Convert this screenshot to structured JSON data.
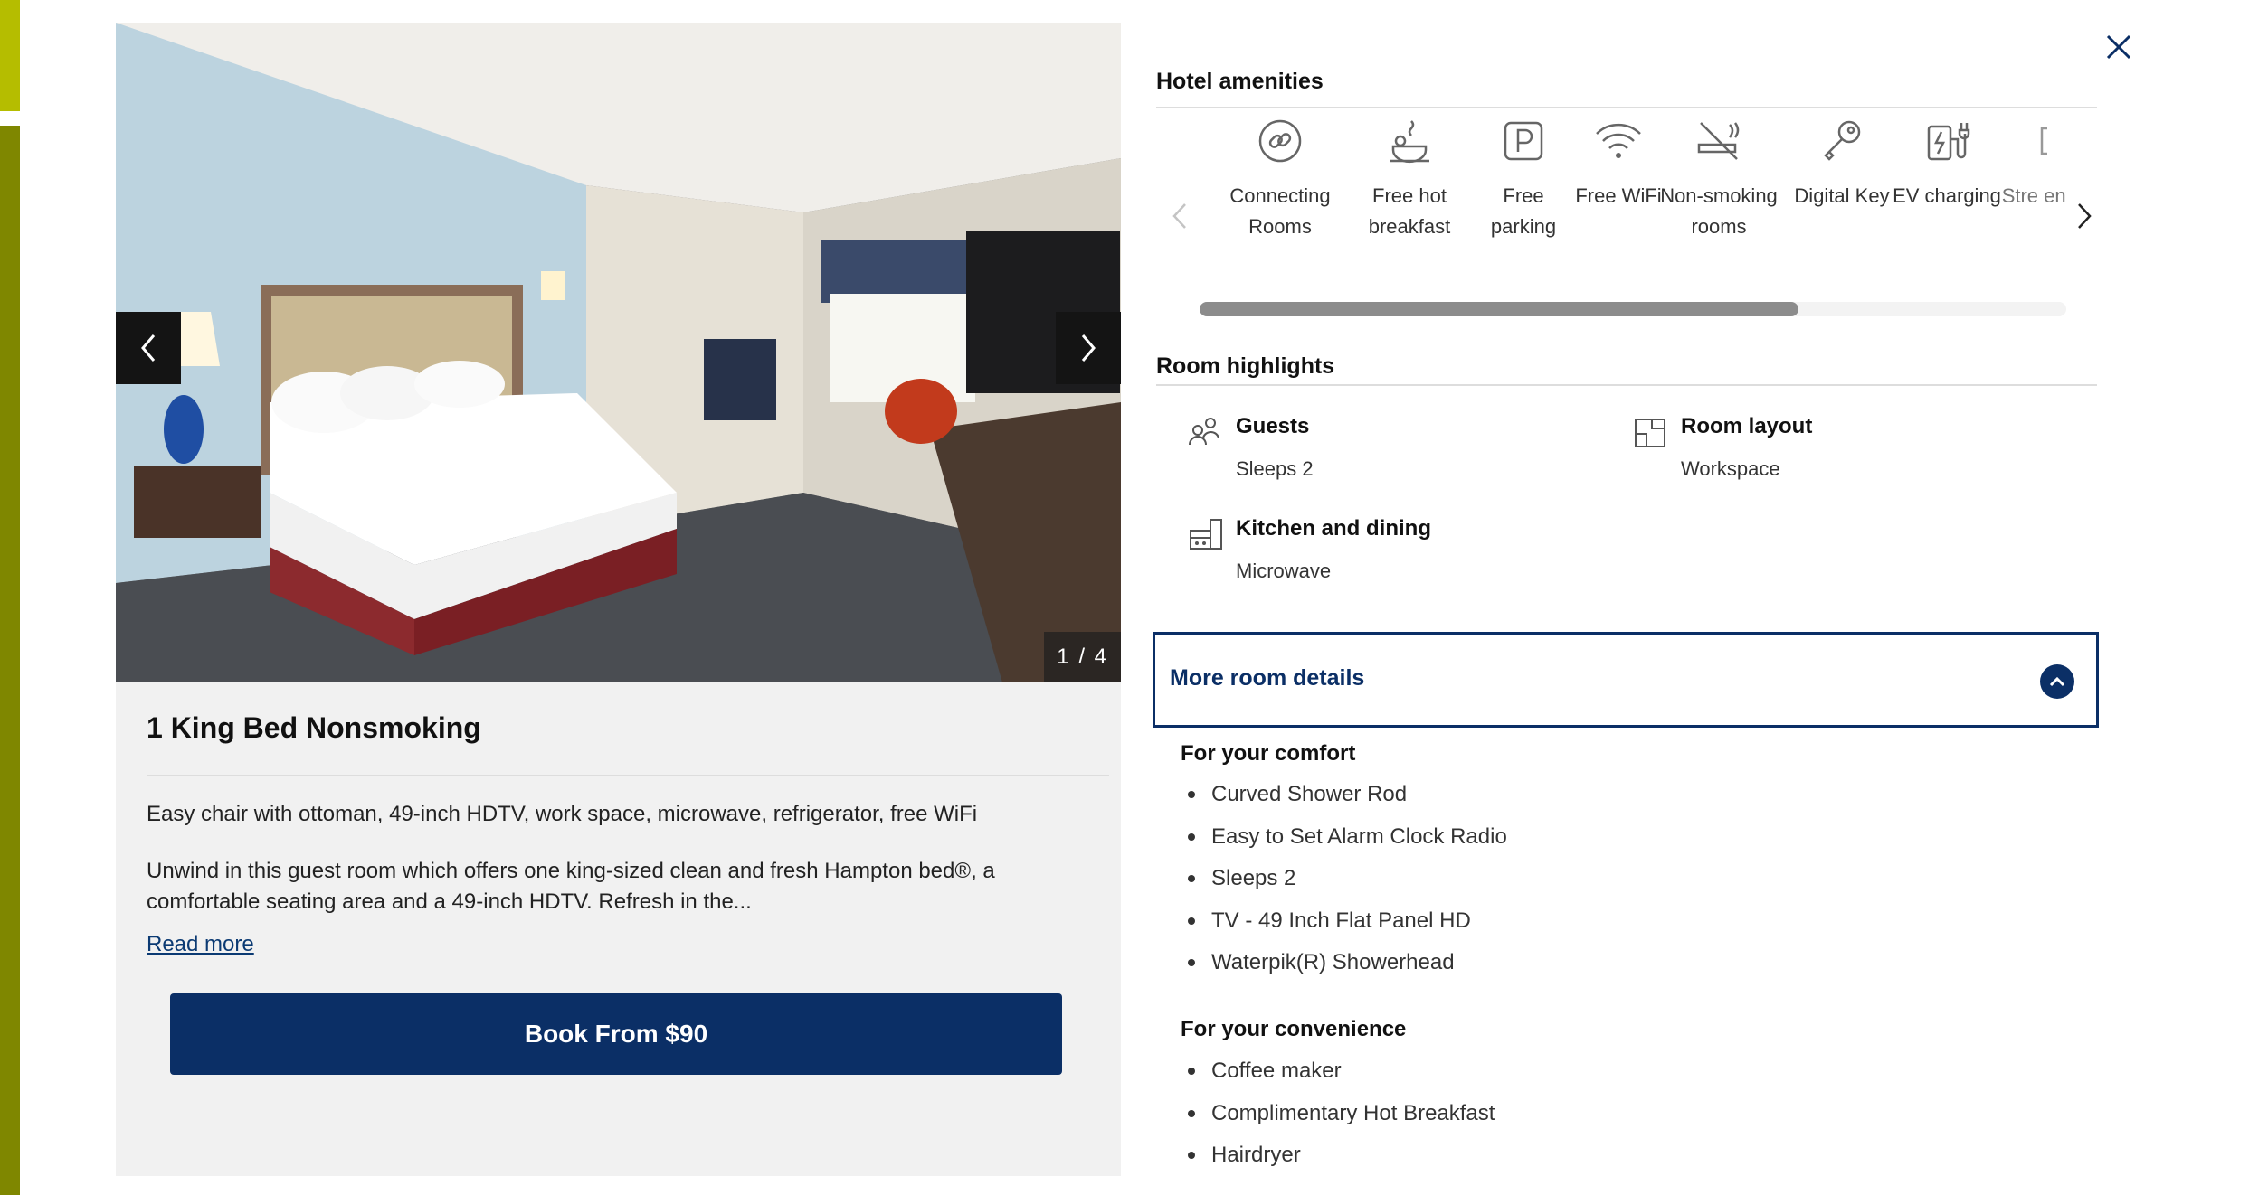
{
  "room": {
    "title": "1 King Bed Nonsmoking",
    "summary": "Easy chair with ottoman, 49-inch HDTV, work space, microwave, refrigerator, free WiFi",
    "description": "Unwind in this guest room which offers one king-sized clean and fresh Hampton bed®, a comfortable seating area and a 49-inch HDTV. Refresh in the...",
    "read_more": "Read more",
    "book_label": "Book From $90"
  },
  "gallery": {
    "counter": "1 / 4",
    "current": 1,
    "total": 4,
    "prev_icon": "chevron-left-icon",
    "next_icon": "chevron-right-icon"
  },
  "amenities": {
    "title": "Hotel amenities",
    "items": [
      {
        "label": "Connecting Rooms",
        "icon": "link-icon"
      },
      {
        "label": "Free hot breakfast",
        "icon": "breakfast-icon"
      },
      {
        "label": "Free parking",
        "icon": "parking-icon"
      },
      {
        "label": "Free WiFi",
        "icon": "wifi-icon"
      },
      {
        "label": "Non-smoking rooms",
        "icon": "no-smoking-icon"
      },
      {
        "label": "Digital Key",
        "icon": "key-icon"
      },
      {
        "label": "EV charging",
        "icon": "ev-charging-icon"
      },
      {
        "label": "Stre enter",
        "icon": "streaming-icon"
      }
    ],
    "scroll_visible_fraction": 0.69
  },
  "highlights": {
    "title": "Room highlights",
    "guests": {
      "title": "Guests",
      "value": "Sleeps 2",
      "icon": "guests-icon"
    },
    "layout": {
      "title": "Room layout",
      "value": "Workspace",
      "icon": "room-layout-icon"
    },
    "kitchen": {
      "title": "Kitchen and dining",
      "value": "Microwave",
      "icon": "kitchen-icon"
    }
  },
  "more_details": {
    "label": "More room details",
    "expanded": true,
    "comfort_title": "For your comfort",
    "comfort_items": [
      "Curved Shower Rod",
      "Easy to Set Alarm Clock Radio",
      "Sleeps 2",
      "TV - 49 Inch Flat Panel HD",
      "Waterpik(R) Showerhead"
    ],
    "convenience_title": "For your convenience",
    "convenience_items": [
      "Coffee maker",
      "Complimentary Hot Breakfast",
      "Hairdryer"
    ]
  },
  "colors": {
    "brand_navy": "#0b2f66",
    "accent_olive": "#b5bd00",
    "accent_olive_dark": "#7f8700"
  }
}
